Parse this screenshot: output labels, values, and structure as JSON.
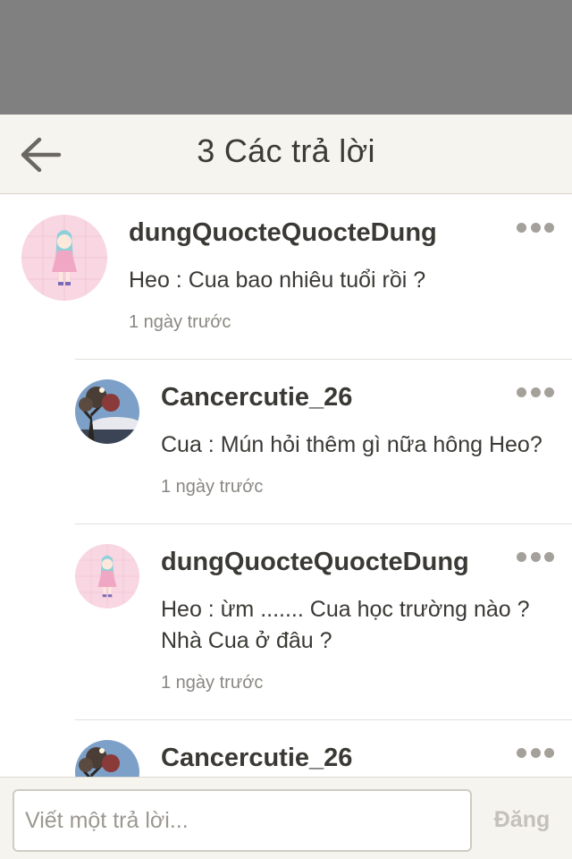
{
  "header": {
    "title": "3 Các trả lời"
  },
  "comments": [
    {
      "username": "dungQuocteQuocteDung",
      "text": [
        "Heo : Cua bao nhiêu tuổi rồi ?"
      ],
      "time": "1 ngày trước",
      "avatar": "pink-girl-avatar"
    },
    {
      "username": "Cancercutie_26",
      "text": [
        "Cua : Mún hỏi thêm gì nữa hông Heo?"
      ],
      "time": "1 ngày trước",
      "avatar": "tree-sky-avatar"
    },
    {
      "username": "dungQuocteQuocteDung",
      "text": [
        "Heo : ừm ....... Cua học trường nào ?",
        "Nhà Cua ở đâu ?"
      ],
      "time": "1 ngày trước",
      "avatar": "pink-girl-avatar"
    },
    {
      "username": "Cancercutie_26",
      "avatar": "tree-sky-avatar"
    }
  ],
  "composer": {
    "placeholder": "Viết một trả lời...",
    "post_label": "Đăng"
  },
  "colors": {
    "status_band": "#808080",
    "header_bg": "#f6f4ee",
    "text": "#3b3935",
    "muted": "#8a8782",
    "post_disabled": "#c4c1ba"
  }
}
